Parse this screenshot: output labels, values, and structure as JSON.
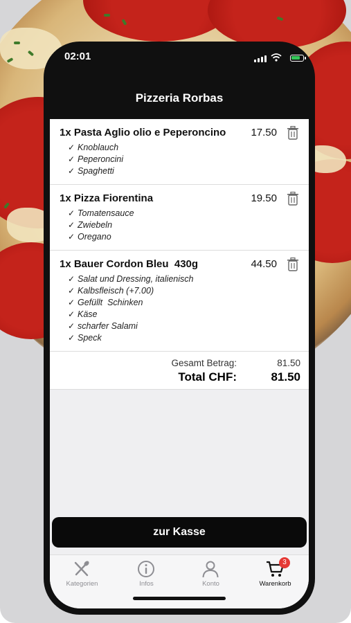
{
  "status_bar": {
    "time": "02:01"
  },
  "header": {
    "title": "Pizzeria Rorbas"
  },
  "cart": {
    "items": [
      {
        "title": "1x Pasta Aglio olio e Peperoncino",
        "price": "17.50",
        "extras": [
          "Knoblauch",
          "Peperoncini",
          "Spaghetti"
        ]
      },
      {
        "title": "1x Pizza Fiorentina",
        "price": "19.50",
        "extras": [
          "Tomatensauce",
          "Zwiebeln",
          "Oregano"
        ]
      },
      {
        "title": "1x Bauer Cordon Bleu  430g",
        "price": "44.50",
        "extras": [
          "Salat und Dressing, italienisch",
          "Kalbsfleisch (+7.00)",
          "Gefüllt  Schinken",
          "Käse",
          "scharfer Salami",
          "Speck"
        ]
      }
    ],
    "check_mark": "✓",
    "summary": {
      "subtotal_label": "Gesamt Betrag:",
      "subtotal_value": "81.50",
      "total_label": "Total CHF:",
      "total_value": "81.50"
    }
  },
  "checkout_button": {
    "label": "zur Kasse"
  },
  "tab_bar": {
    "tabs": [
      {
        "label": "Kategorien",
        "icon": "cutlery-icon"
      },
      {
        "label": "Infos",
        "icon": "info-icon"
      },
      {
        "label": "Konto",
        "icon": "user-icon"
      },
      {
        "label": "Warenkorb",
        "icon": "cart-icon",
        "badge": "3",
        "active": true
      }
    ]
  },
  "colors": {
    "accent": "#0a0a0a",
    "badge": "#e53935",
    "background": "#efeff1"
  }
}
